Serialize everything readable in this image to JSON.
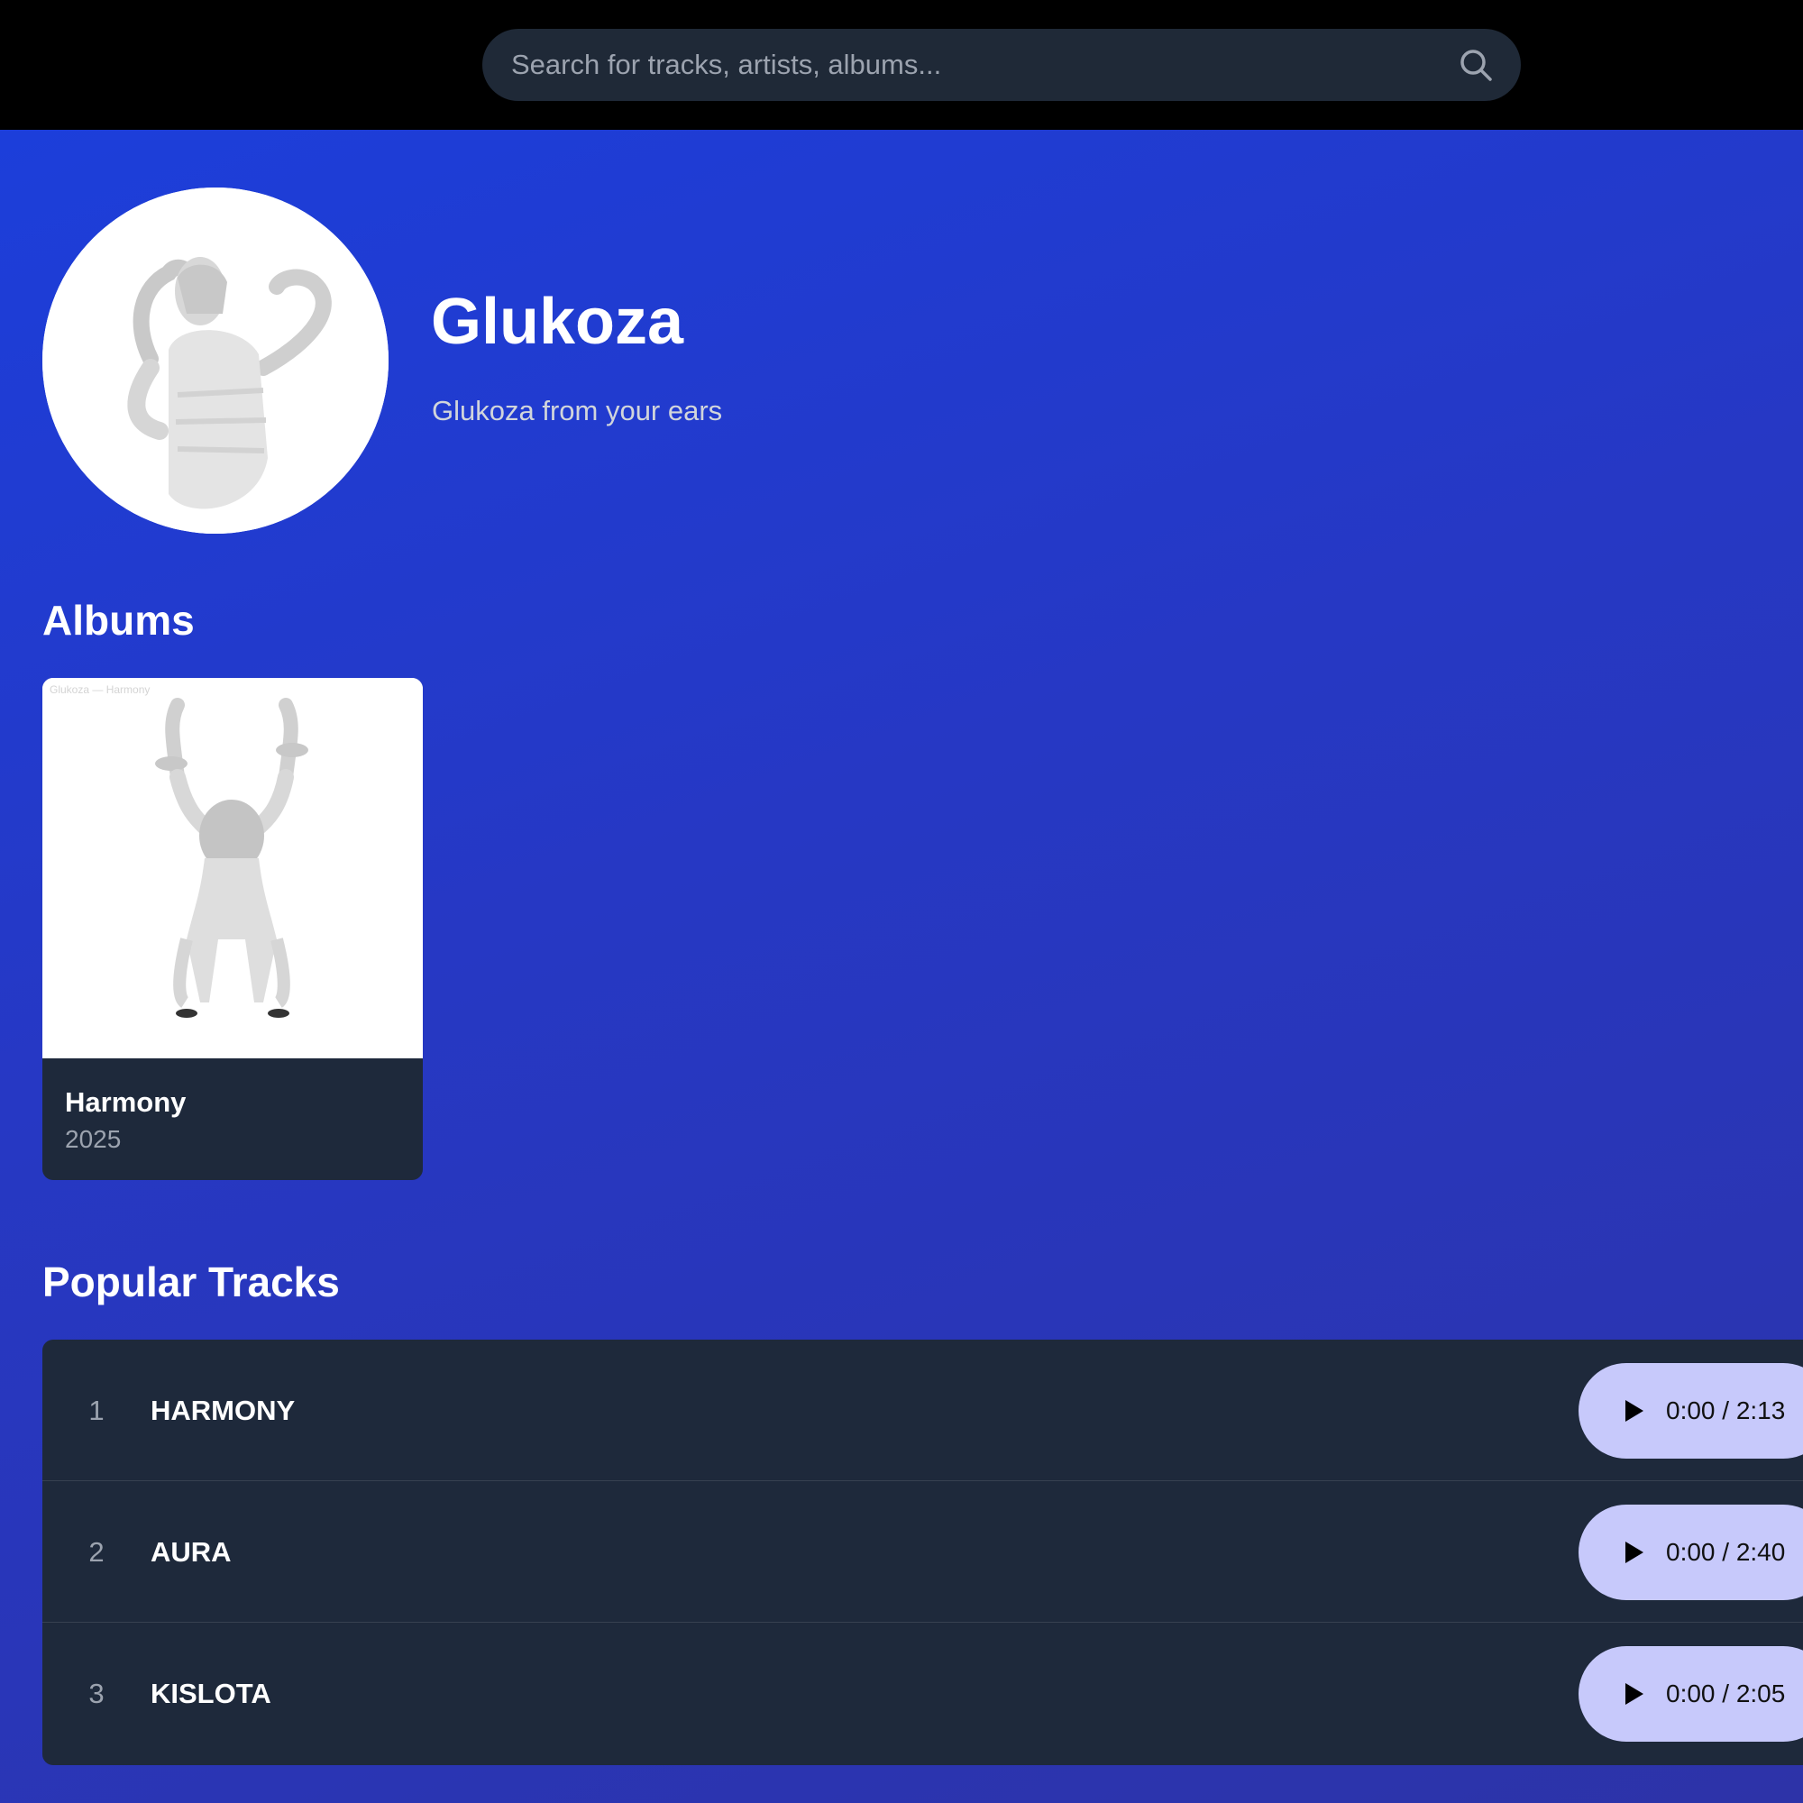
{
  "search": {
    "placeholder": "Search for tracks, artists, albums...",
    "icon": "search-icon"
  },
  "artist": {
    "name": "Glukoza",
    "bio": "Glukoza from your ears"
  },
  "albums": {
    "heading": "Albums",
    "items": [
      {
        "title": "Harmony",
        "year": "2025",
        "cover_text": "Glukoza — Harmony"
      }
    ]
  },
  "tracks": {
    "heading": "Popular Tracks",
    "items": [
      {
        "number": "1",
        "title": "HARMONY",
        "time": "0:00 / 2:13"
      },
      {
        "number": "2",
        "title": "AURA",
        "time": "0:00 / 2:40"
      },
      {
        "number": "3",
        "title": "KISLOTA",
        "time": "0:00 / 2:05"
      }
    ]
  },
  "colors": {
    "topbar": "#000000",
    "background_start": "#1b3fdd",
    "background_end": "#2d33a8",
    "card": "#1e293b",
    "player": "#c7c9fb"
  }
}
